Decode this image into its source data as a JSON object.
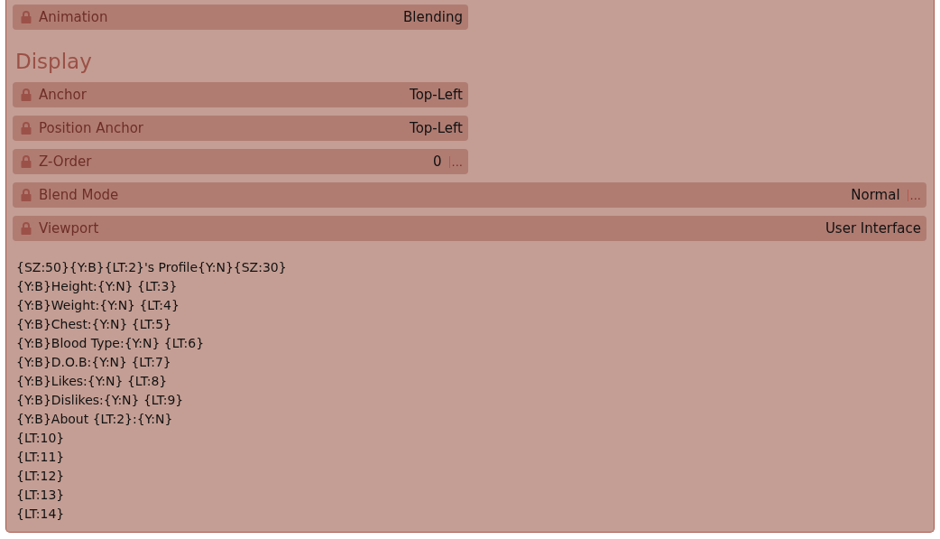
{
  "top_rows": [
    {
      "label": "Animation",
      "value": "Blending",
      "locked": true,
      "kind": "short"
    }
  ],
  "section": {
    "title": "Display",
    "rows": [
      {
        "label": "Anchor",
        "value": "Top-Left",
        "locked": true,
        "kind": "short"
      },
      {
        "label": "Position Anchor",
        "value": "Top-Left",
        "locked": true,
        "kind": "short"
      },
      {
        "label": "Z-Order",
        "value": "0",
        "more": "...",
        "locked": true,
        "kind": "short"
      },
      {
        "label": "Blend Mode",
        "value": "Normal",
        "more": "...",
        "locked": true,
        "kind": "long"
      },
      {
        "label": "Viewport",
        "value": "User Interface",
        "locked": true,
        "kind": "long"
      }
    ]
  },
  "text_lines": [
    "{SZ:50}{Y:B}{LT:2}'s Profile{Y:N}{SZ:30}",
    "{Y:B}Height:{Y:N} {LT:3}",
    "{Y:B}Weight:{Y:N} {LT:4}",
    "{Y:B}Chest:{Y:N} {LT:5}",
    "{Y:B}Blood Type:{Y:N} {LT:6}",
    "{Y:B}D.O.B:{Y:N} {LT:7}",
    "{Y:B}Likes:{Y:N} {LT:8}",
    "{Y:B}Dislikes:{Y:N} {LT:9}",
    "{Y:B}About {LT:2}:{Y:N}",
    "{LT:10}",
    "{LT:11}",
    "{LT:12}",
    "{LT:13}",
    "{LT:14}"
  ]
}
